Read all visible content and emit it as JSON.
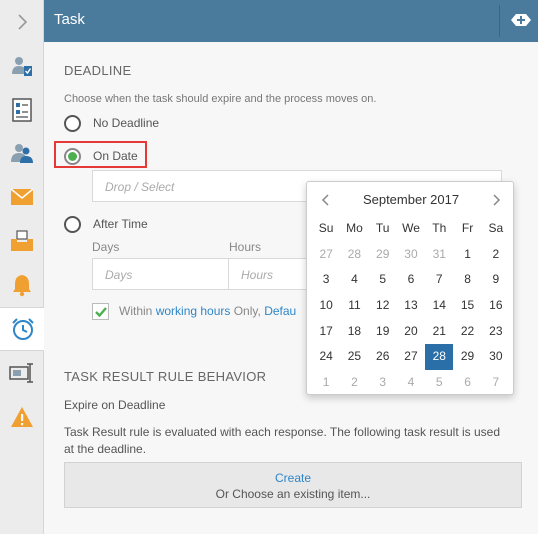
{
  "header": {
    "title": "Task"
  },
  "deadline": {
    "section_title": "DEADLINE",
    "description": "Choose when the task should expire and the process moves on.",
    "options": [
      {
        "label": "No Deadline",
        "selected": false
      },
      {
        "label": "On Date",
        "selected": true
      },
      {
        "label": "After Time",
        "selected": false
      }
    ],
    "date_placeholder": "Drop / Select",
    "days_label": "Days",
    "hours_label": "Hours",
    "days_placeholder": "Days",
    "hours_placeholder": "Hours",
    "working_hours_checked": true,
    "working_prefix": "Within ",
    "working_link": "working hours",
    "working_mid": " Only, ",
    "working_link2": "Defau"
  },
  "calendar": {
    "month_label": "September 2017",
    "weekdays": [
      "Su",
      "Mo",
      "Tu",
      "We",
      "Th",
      "Fr",
      "Sa"
    ],
    "weeks": [
      [
        "27",
        "28",
        "29",
        "30",
        "31",
        "1",
        "2"
      ],
      [
        "3",
        "4",
        "5",
        "6",
        "7",
        "8",
        "9"
      ],
      [
        "10",
        "11",
        "12",
        "13",
        "14",
        "15",
        "16"
      ],
      [
        "17",
        "18",
        "19",
        "20",
        "21",
        "22",
        "23"
      ],
      [
        "24",
        "25",
        "26",
        "27",
        "28",
        "29",
        "30"
      ],
      [
        "1",
        "2",
        "3",
        "4",
        "5",
        "6",
        "7"
      ]
    ],
    "selected_day": "28",
    "selected_color": "#2a6fa8"
  },
  "result": {
    "section_title": "TASK RESULT RULE BEHAVIOR",
    "mode": "Expire on Deadline",
    "description_line1": "Task Result rule is evaluated with each response. The following task result is used",
    "description_line2": "at the deadline.",
    "create_label": "Create",
    "choose_label": "Or Choose an existing item..."
  },
  "colors": {
    "header": "#4a7a9c",
    "accent_green": "#4caf50",
    "highlight_red": "#e53935",
    "link": "#2e86c9"
  },
  "rail_icons": [
    "chevron-right-icon",
    "user-task-icon",
    "form-icon",
    "users-icon",
    "email-icon",
    "inbox-icon",
    "bell-icon",
    "alarm-clock-icon",
    "text-field-icon",
    "warning-icon"
  ]
}
